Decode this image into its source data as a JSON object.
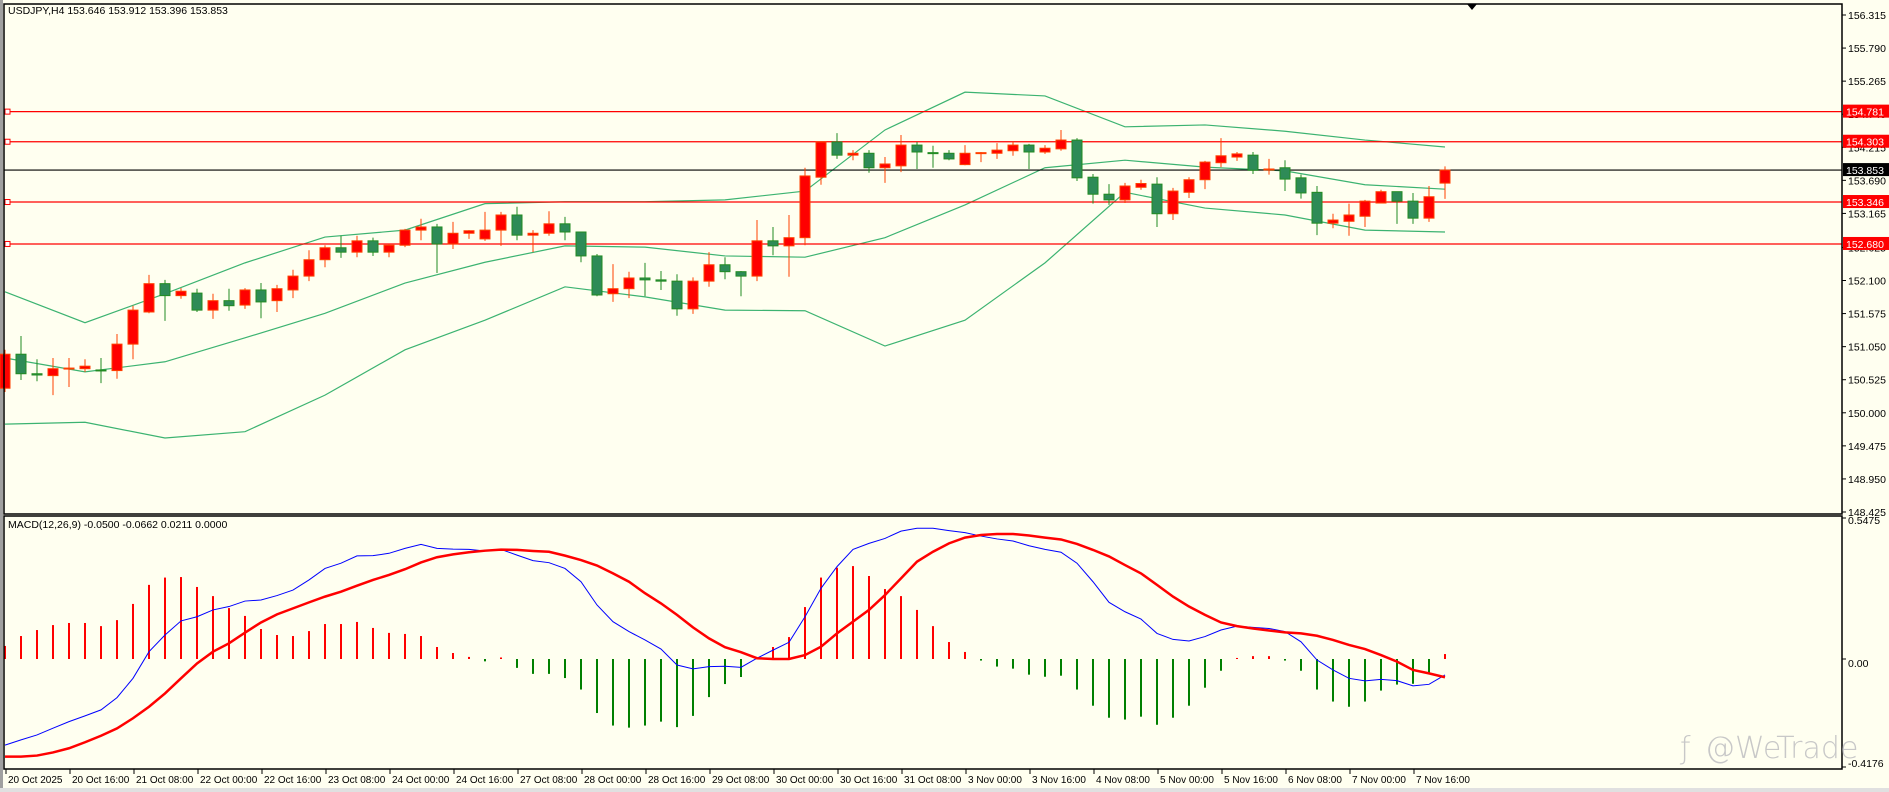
{
  "header": {
    "symbol_line": "USDJPY,H4  153.646 153.912 153.396 153.853"
  },
  "macd_header": {
    "label": "MACD(12,26,9) -0.0500 -0.0662 0.0211 0.0000"
  },
  "watermark": {
    "text": "@WeTrade"
  },
  "colors": {
    "background": "#fffff0",
    "bull": "#ff0000",
    "bull_outline": "#ff4000",
    "bear": "#2e8b57",
    "bear_outline": "#228b22",
    "bands": "#3cb371",
    "level_line": "#ff0000",
    "current_price": "#000000",
    "macd_line": "#0000ff",
    "signal_line": "#ff0000",
    "hist_pos": "#ff0000",
    "hist_neg": "#008000"
  },
  "chart_data": [
    {
      "type": "candlestick",
      "title": "USDJPY,H4",
      "ylim": [
        148.425,
        156.315
      ],
      "price_ticks": [
        "156.315",
        "155.790",
        "155.265",
        "154.740",
        "154.215",
        "153.690",
        "153.165",
        "152.625",
        "152.100",
        "151.575",
        "151.050",
        "150.525",
        "150.000",
        "149.475",
        "148.950",
        "148.425"
      ],
      "time_labels": [
        "20 Oct 2025",
        "20 Oct 16:00",
        "21 Oct 08:00",
        "22 Oct 00:00",
        "22 Oct 16:00",
        "23 Oct 08:00",
        "24 Oct 00:00",
        "24 Oct 16:00",
        "27 Oct 08:00",
        "28 Oct 00:00",
        "28 Oct 16:00",
        "29 Oct 08:00",
        "30 Oct 00:00",
        "30 Oct 16:00",
        "31 Oct 08:00",
        "3 Nov 00:00",
        "3 Nov 16:00",
        "4 Nov 08:00",
        "5 Nov 00:00",
        "5 Nov 16:00",
        "6 Nov 08:00",
        "7 Nov 00:00",
        "7 Nov 16:00"
      ],
      "bars_per_time_label": 4,
      "horizontal_levels": [
        {
          "price": "154.781",
          "kind": "level"
        },
        {
          "price": "154.303",
          "kind": "level"
        },
        {
          "price": "153.853",
          "kind": "current"
        },
        {
          "price": "153.346",
          "kind": "level"
        },
        {
          "price": "152.680",
          "kind": "level"
        }
      ],
      "ohlc": [
        [
          150.39,
          151.0,
          150.33,
          150.93
        ],
        [
          150.93,
          151.22,
          150.52,
          150.62
        ],
        [
          150.62,
          150.85,
          150.5,
          150.6
        ],
        [
          150.59,
          150.87,
          150.28,
          150.7
        ],
        [
          150.7,
          150.87,
          150.41,
          150.71
        ],
        [
          150.7,
          150.85,
          150.65,
          150.74
        ],
        [
          150.68,
          150.87,
          150.47,
          150.67
        ],
        [
          150.67,
          151.25,
          150.54,
          151.09
        ],
        [
          151.09,
          151.7,
          150.85,
          151.63
        ],
        [
          151.6,
          152.19,
          151.58,
          152.05
        ],
        [
          152.05,
          152.11,
          151.46,
          151.86
        ],
        [
          151.86,
          151.98,
          151.81,
          151.93
        ],
        [
          151.9,
          151.97,
          151.6,
          151.63
        ],
        [
          151.63,
          151.89,
          151.49,
          151.78
        ],
        [
          151.78,
          151.97,
          151.62,
          151.7
        ],
        [
          151.71,
          151.98,
          151.65,
          151.95
        ],
        [
          151.95,
          152.06,
          151.5,
          151.76
        ],
        [
          151.78,
          152.03,
          151.6,
          151.97
        ],
        [
          151.95,
          152.27,
          151.82,
          152.17
        ],
        [
          152.17,
          152.58,
          152.09,
          152.43
        ],
        [
          152.43,
          152.66,
          152.31,
          152.62
        ],
        [
          152.62,
          152.81,
          152.46,
          152.55
        ],
        [
          152.55,
          152.81,
          152.47,
          152.73
        ],
        [
          152.73,
          152.78,
          152.49,
          152.55
        ],
        [
          152.55,
          152.68,
          152.47,
          152.66
        ],
        [
          152.66,
          152.92,
          152.63,
          152.9
        ],
        [
          152.9,
          153.08,
          152.74,
          152.95
        ],
        [
          152.95,
          153.0,
          152.22,
          152.68
        ],
        [
          152.68,
          153.03,
          152.6,
          152.85
        ],
        [
          152.85,
          152.9,
          152.76,
          152.89
        ],
        [
          152.76,
          153.19,
          152.73,
          152.9
        ],
        [
          152.9,
          153.19,
          152.65,
          153.14
        ],
        [
          153.14,
          153.27,
          152.74,
          152.82
        ],
        [
          152.82,
          152.9,
          152.55,
          152.85
        ],
        [
          152.85,
          153.2,
          152.81,
          153.0
        ],
        [
          153.0,
          153.11,
          152.74,
          152.87
        ],
        [
          152.87,
          152.87,
          152.39,
          152.49
        ],
        [
          152.49,
          152.52,
          151.85,
          151.87
        ],
        [
          151.89,
          152.36,
          151.76,
          151.97
        ],
        [
          151.97,
          152.24,
          151.82,
          152.14
        ],
        [
          152.14,
          152.38,
          151.85,
          152.11
        ],
        [
          152.11,
          152.25,
          151.95,
          152.09
        ],
        [
          152.09,
          152.2,
          151.54,
          151.65
        ],
        [
          151.65,
          152.15,
          151.57,
          152.09
        ],
        [
          152.09,
          152.55,
          152.0,
          152.35
        ],
        [
          152.35,
          152.47,
          152.12,
          152.24
        ],
        [
          152.24,
          152.25,
          151.85,
          152.17
        ],
        [
          152.17,
          153.06,
          152.09,
          152.73
        ],
        [
          152.73,
          152.95,
          152.5,
          152.65
        ],
        [
          152.65,
          153.14,
          152.16,
          152.78
        ],
        [
          152.78,
          153.89,
          152.66,
          153.76
        ],
        [
          153.74,
          154.3,
          153.62,
          154.3
        ],
        [
          154.3,
          154.44,
          154.03,
          154.09
        ],
        [
          154.09,
          154.17,
          154.01,
          154.12
        ],
        [
          154.12,
          154.17,
          153.81,
          153.89
        ],
        [
          153.89,
          154.06,
          153.65,
          153.95
        ],
        [
          153.92,
          154.41,
          153.82,
          154.25
        ],
        [
          154.25,
          154.3,
          153.87,
          154.14
        ],
        [
          154.13,
          154.24,
          153.89,
          154.12
        ],
        [
          154.12,
          154.17,
          154.01,
          154.03
        ],
        [
          153.94,
          154.25,
          153.93,
          154.12
        ],
        [
          154.12,
          154.14,
          153.98,
          154.13
        ],
        [
          154.12,
          154.28,
          154.03,
          154.17
        ],
        [
          154.16,
          154.3,
          154.08,
          154.25
        ],
        [
          154.25,
          154.27,
          153.87,
          154.14
        ],
        [
          154.14,
          154.25,
          154.11,
          154.2
        ],
        [
          154.19,
          154.49,
          154.16,
          154.33
        ],
        [
          154.33,
          154.36,
          153.68,
          153.73
        ],
        [
          153.74,
          153.79,
          153.32,
          153.47
        ],
        [
          153.47,
          153.63,
          153.3,
          153.38
        ],
        [
          153.38,
          153.65,
          153.33,
          153.6
        ],
        [
          153.58,
          153.7,
          153.54,
          153.64
        ],
        [
          153.63,
          153.74,
          152.95,
          153.16
        ],
        [
          153.16,
          153.57,
          153.06,
          153.52
        ],
        [
          153.5,
          153.74,
          153.41,
          153.7
        ],
        [
          153.7,
          154.0,
          153.55,
          153.98
        ],
        [
          153.97,
          154.36,
          153.9,
          154.08
        ],
        [
          154.06,
          154.14,
          154.0,
          154.11
        ],
        [
          154.09,
          154.14,
          153.79,
          153.85
        ],
        [
          153.86,
          154.03,
          153.78,
          153.87
        ],
        [
          153.89,
          154.01,
          153.52,
          153.71
        ],
        [
          153.73,
          153.78,
          153.4,
          153.49
        ],
        [
          153.5,
          153.6,
          152.82,
          153.01
        ],
        [
          153.01,
          153.16,
          152.93,
          153.06
        ],
        [
          153.04,
          153.32,
          152.81,
          153.14
        ],
        [
          153.12,
          153.38,
          152.95,
          153.36
        ],
        [
          153.33,
          153.54,
          153.33,
          153.51
        ],
        [
          153.51,
          153.51,
          153.0,
          153.36
        ],
        [
          153.36,
          153.49,
          153.0,
          153.09
        ],
        [
          153.09,
          153.6,
          153.03,
          153.43
        ],
        [
          153.646,
          153.912,
          153.396,
          153.853
        ]
      ],
      "bollinger": {
        "sample_every_bars": 5,
        "upper": [
          151.92,
          151.43,
          151.89,
          152.38,
          152.79,
          152.9,
          153.32,
          153.35,
          153.35,
          153.38,
          153.52,
          154.49,
          155.09,
          155.03,
          154.54,
          154.57,
          154.47,
          154.33,
          154.22
        ],
        "middle": [
          150.87,
          150.65,
          150.81,
          151.19,
          151.58,
          152.06,
          152.39,
          152.65,
          152.63,
          152.49,
          152.47,
          152.78,
          153.3,
          153.89,
          154.01,
          153.9,
          153.84,
          153.62,
          153.55
        ],
        "lower": [
          149.82,
          149.85,
          149.6,
          149.7,
          150.28,
          151.0,
          151.47,
          152.0,
          151.84,
          151.63,
          151.62,
          151.06,
          151.47,
          152.38,
          153.5,
          153.25,
          153.14,
          152.9,
          152.87
        ]
      }
    },
    {
      "type": "macd",
      "title": "MACD(12,26,9)",
      "ylim": [
        -0.4176,
        0.5475
      ],
      "ticks": [
        "0.5475",
        "0.00",
        "-0.4176"
      ],
      "histogram": [
        0.05,
        0.088,
        0.111,
        0.13,
        0.138,
        0.138,
        0.126,
        0.149,
        0.211,
        0.284,
        0.312,
        0.314,
        0.276,
        0.241,
        0.195,
        0.165,
        0.115,
        0.092,
        0.088,
        0.107,
        0.134,
        0.134,
        0.142,
        0.119,
        0.1,
        0.096,
        0.088,
        0.046,
        0.023,
        0.008,
        -0.009,
        0.002,
        -0.034,
        -0.057,
        -0.057,
        -0.073,
        -0.117,
        -0.207,
        -0.255,
        -0.263,
        -0.255,
        -0.24,
        -0.261,
        -0.218,
        -0.146,
        -0.096,
        -0.069,
        0.002,
        0.046,
        0.084,
        0.199,
        0.312,
        0.35,
        0.356,
        0.318,
        0.268,
        0.241,
        0.188,
        0.126,
        0.065,
        0.027,
        -0.006,
        -0.029,
        -0.037,
        -0.06,
        -0.068,
        -0.064,
        -0.117,
        -0.179,
        -0.225,
        -0.232,
        -0.221,
        -0.252,
        -0.225,
        -0.179,
        -0.11,
        -0.045,
        0.004,
        0.011,
        0.011,
        -0.006,
        -0.045,
        -0.117,
        -0.163,
        -0.183,
        -0.163,
        -0.121,
        -0.098,
        -0.095,
        -0.056,
        0.019
      ],
      "macd": [
        -0.33,
        -0.31,
        -0.291,
        -0.265,
        -0.24,
        -0.218,
        -0.195,
        -0.148,
        -0.074,
        0.028,
        0.092,
        0.146,
        0.162,
        0.188,
        0.201,
        0.222,
        0.226,
        0.243,
        0.264,
        0.303,
        0.347,
        0.367,
        0.395,
        0.396,
        0.405,
        0.424,
        0.439,
        0.424,
        0.421,
        0.42,
        0.414,
        0.42,
        0.398,
        0.377,
        0.369,
        0.347,
        0.296,
        0.207,
        0.143,
        0.105,
        0.073,
        0.038,
        -0.023,
        -0.038,
        -0.029,
        -0.028,
        -0.032,
        0.003,
        0.034,
        0.064,
        0.162,
        0.271,
        0.354,
        0.42,
        0.443,
        0.462,
        0.49,
        0.501,
        0.501,
        0.492,
        0.484,
        0.471,
        0.46,
        0.452,
        0.434,
        0.42,
        0.409,
        0.367,
        0.296,
        0.217,
        0.181,
        0.153,
        0.098,
        0.075,
        0.069,
        0.086,
        0.111,
        0.126,
        0.121,
        0.117,
        0.105,
        0.066,
        -0.004,
        -0.042,
        -0.074,
        -0.084,
        -0.078,
        -0.083,
        -0.103,
        -0.097,
        -0.061
      ],
      "signal": [
        -0.374,
        -0.374,
        -0.37,
        -0.358,
        -0.342,
        -0.319,
        -0.294,
        -0.266,
        -0.227,
        -0.183,
        -0.132,
        -0.074,
        -0.017,
        0.028,
        0.06,
        0.101,
        0.14,
        0.171,
        0.194,
        0.217,
        0.239,
        0.258,
        0.281,
        0.303,
        0.322,
        0.344,
        0.37,
        0.39,
        0.401,
        0.409,
        0.415,
        0.419,
        0.418,
        0.414,
        0.411,
        0.396,
        0.379,
        0.358,
        0.328,
        0.296,
        0.252,
        0.213,
        0.169,
        0.121,
        0.079,
        0.045,
        0.026,
        0.003,
        0.0,
        0.0,
        0.015,
        0.047,
        0.098,
        0.143,
        0.188,
        0.245,
        0.309,
        0.373,
        0.411,
        0.443,
        0.465,
        0.475,
        0.479,
        0.479,
        0.473,
        0.465,
        0.458,
        0.441,
        0.418,
        0.393,
        0.36,
        0.328,
        0.284,
        0.239,
        0.201,
        0.169,
        0.14,
        0.126,
        0.117,
        0.109,
        0.102,
        0.098,
        0.089,
        0.073,
        0.054,
        0.038,
        0.015,
        -0.01,
        -0.042,
        -0.055,
        -0.07
      ]
    }
  ]
}
